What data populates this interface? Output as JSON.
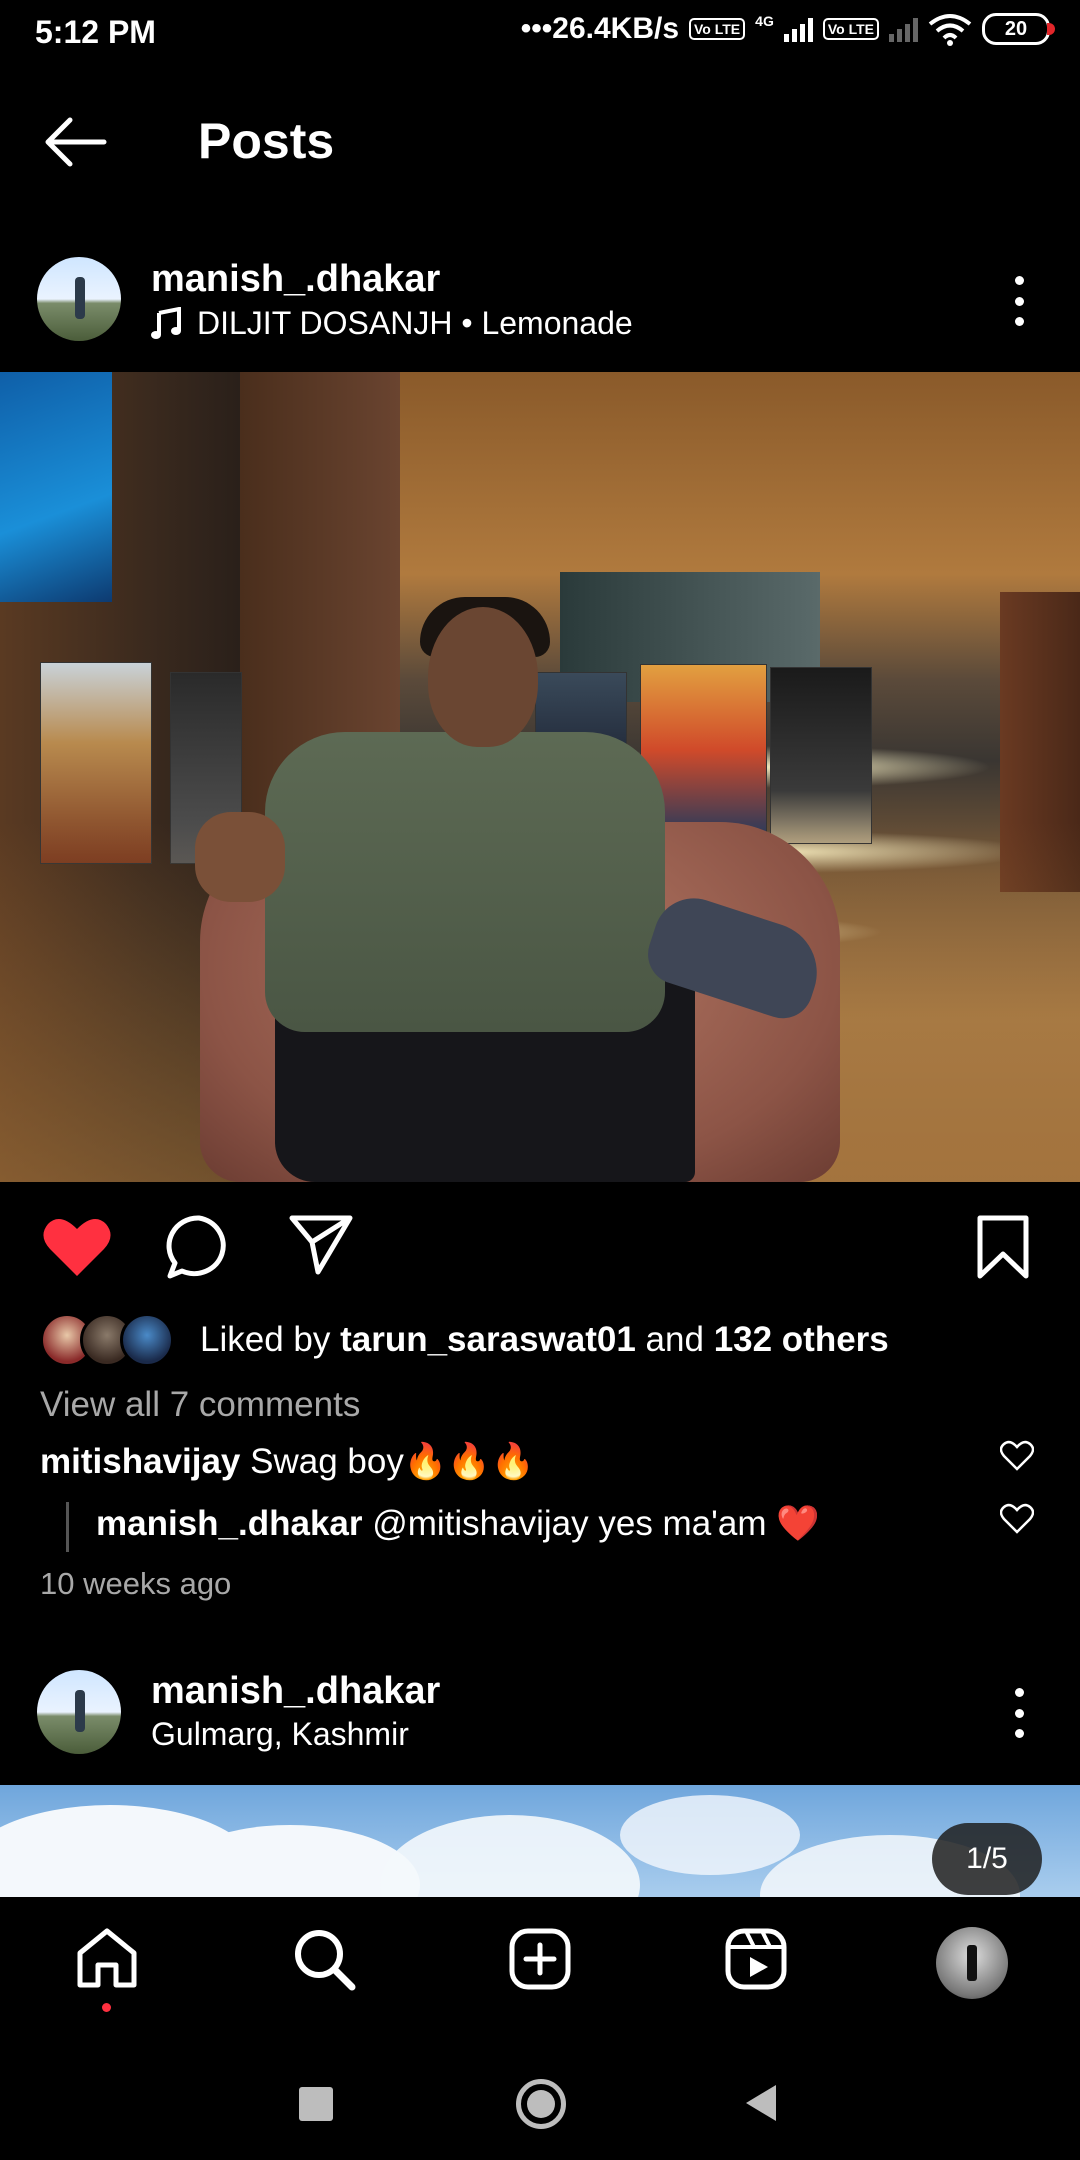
{
  "status_bar": {
    "time": "5:12 PM",
    "speed": "•••26.4KB/s",
    "volte1": "Vo LTE",
    "net_label": "4G",
    "volte2": "Vo LTE",
    "battery": "20"
  },
  "header": {
    "title": "Posts"
  },
  "post1": {
    "username": "manish_.dhakar",
    "audio": "DILJIT DOSANJH • Lemonade",
    "liked_prefix": "Liked by ",
    "liked_user": "tarun_saraswat01",
    "liked_and": " and ",
    "liked_others": "132 others",
    "view_all": "View all 7 comments",
    "comments": [
      {
        "user": "mitishavijay",
        "text": " Swag boy🔥🔥🔥"
      },
      {
        "user": "manish_.dhakar",
        "text": " @mitishavijay yes ma'am ❤️"
      }
    ],
    "time_ago": "10 weeks ago"
  },
  "post2": {
    "username": "manish_.dhakar",
    "location": "Gulmarg, Kashmir",
    "counter": "1/5"
  },
  "icons": {
    "like": "heart-filled",
    "comment": "speech-bubble",
    "share": "paper-plane",
    "save": "bookmark",
    "mute": "speaker-muted"
  },
  "colors": {
    "like_red": "#ff3040",
    "muted_text": "#a8a8a8"
  }
}
